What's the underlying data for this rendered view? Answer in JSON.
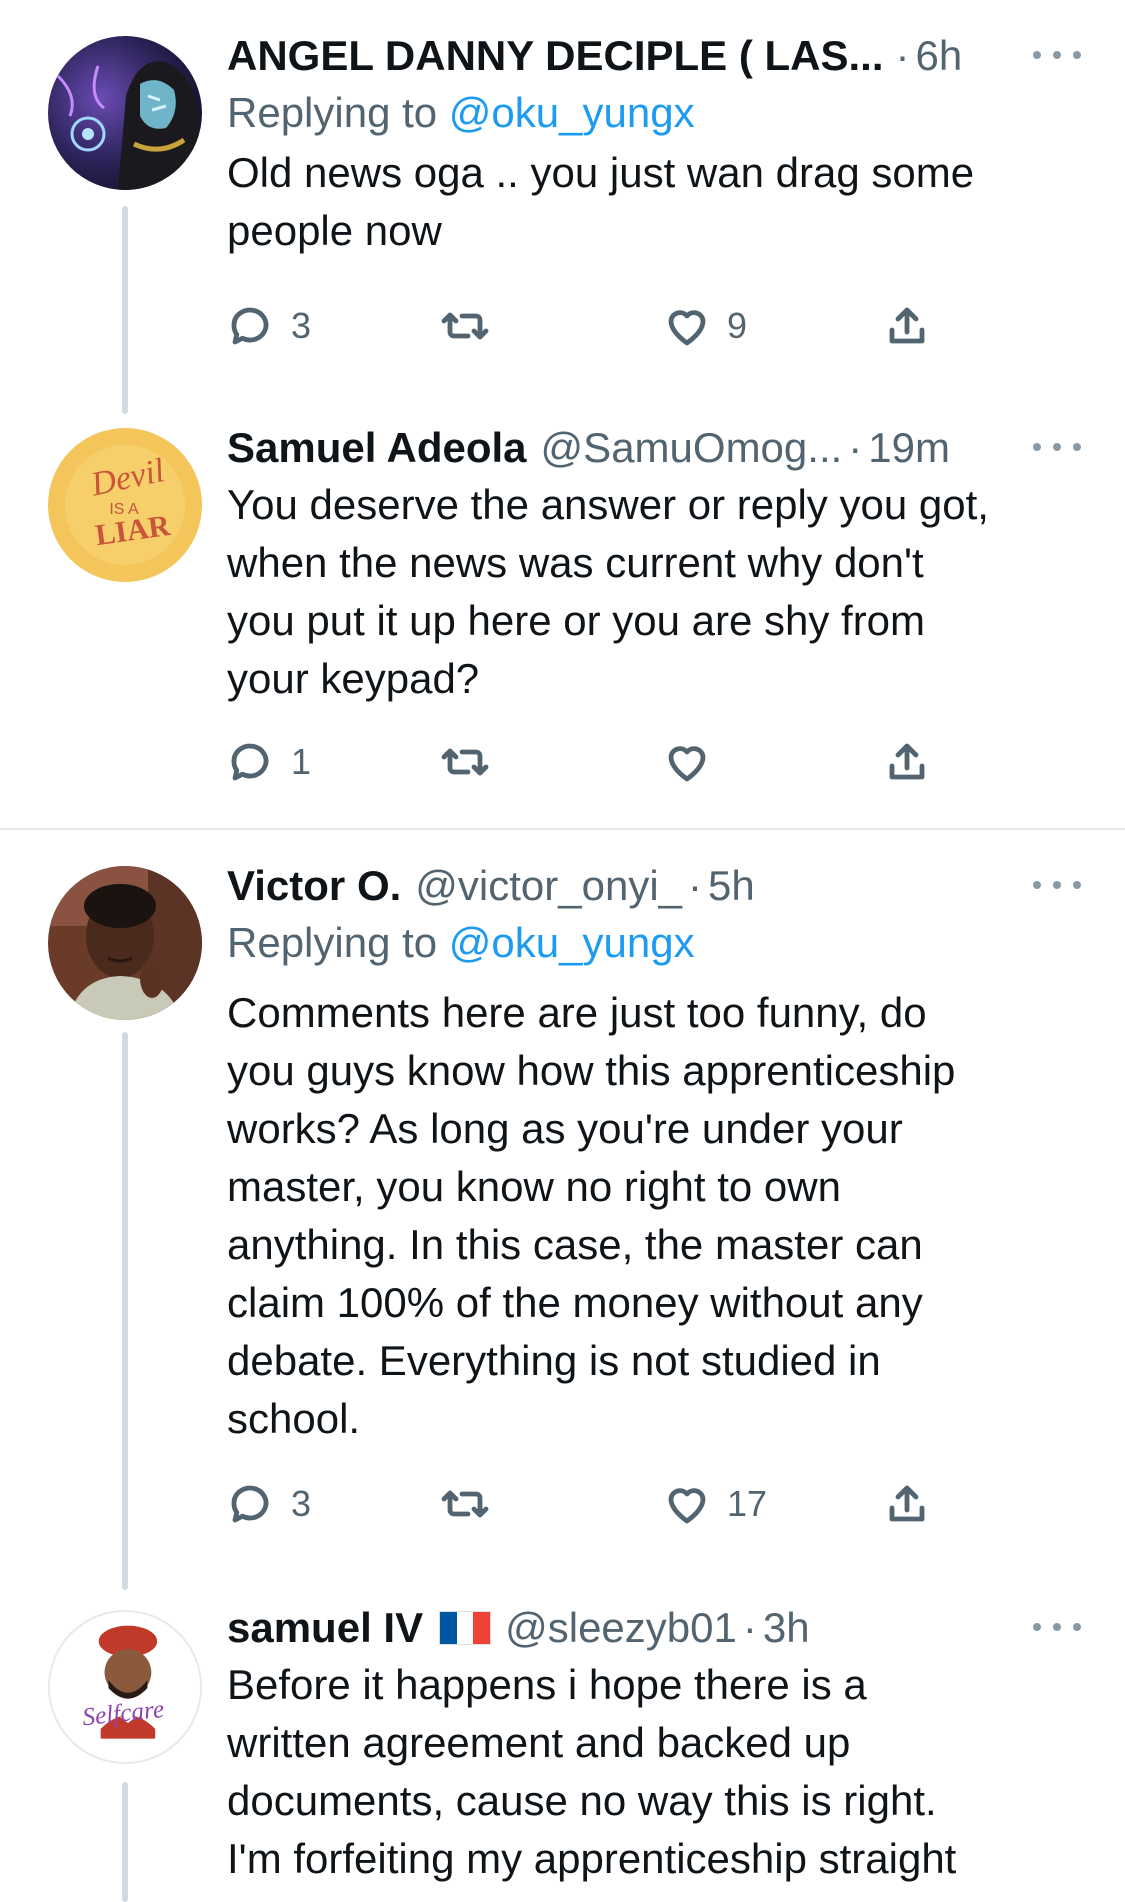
{
  "tweets": [
    {
      "name": "ANGEL DANNY DECIPLE ( LAS...",
      "handle": "",
      "time": "6h",
      "replying_label": "Replying to ",
      "replying_handle": "@oku_yungx",
      "text": "Old news oga .. you just wan drag some\npeople now",
      "replies": "3",
      "retweets": "",
      "likes": "9"
    },
    {
      "name": "Samuel Adeola",
      "handle": "@SamuOmog...",
      "time": "19m",
      "text": "You deserve the answer or reply you got,\nwhen the news was current why don't\nyou put it up here or you are shy from\nyour keypad?",
      "replies": "1",
      "retweets": "",
      "likes": "",
      "avatar_text_1": "Devil",
      "avatar_text_2": "IS A",
      "avatar_text_3": "LIAR"
    },
    {
      "name": "Victor O.",
      "handle": "@victor_onyi_",
      "time": "5h",
      "replying_label": "Replying to ",
      "replying_handle": "@oku_yungx",
      "text": "Comments here are just too funny, do\nyou guys know how this apprenticeship\nworks? As long as you're under your\nmaster, you know no right to own\nanything. In this case, the master can\nclaim 100% of the money without any\ndebate. Everything is not studied in\nschool.",
      "replies": "3",
      "retweets": "",
      "likes": "17"
    },
    {
      "name": "samuel IV",
      "handle": "@sleezyb01",
      "time": "3h",
      "text": "Before it happens i hope there is a\nwritten agreement and backed up\ndocuments, cause no way this is right.\nI'm forfeiting my apprenticeship straight",
      "avatar_text": "Selfcare"
    }
  ],
  "sep": "·",
  "colors": {
    "link": "#1d9bf0",
    "secondary_text": "#536471",
    "thread_line": "#cfd9de",
    "divider": "#e6e9ec"
  },
  "icons": [
    "reply-icon",
    "retweet-icon",
    "like-icon",
    "share-icon",
    "more-icon",
    "flag-icon"
  ]
}
